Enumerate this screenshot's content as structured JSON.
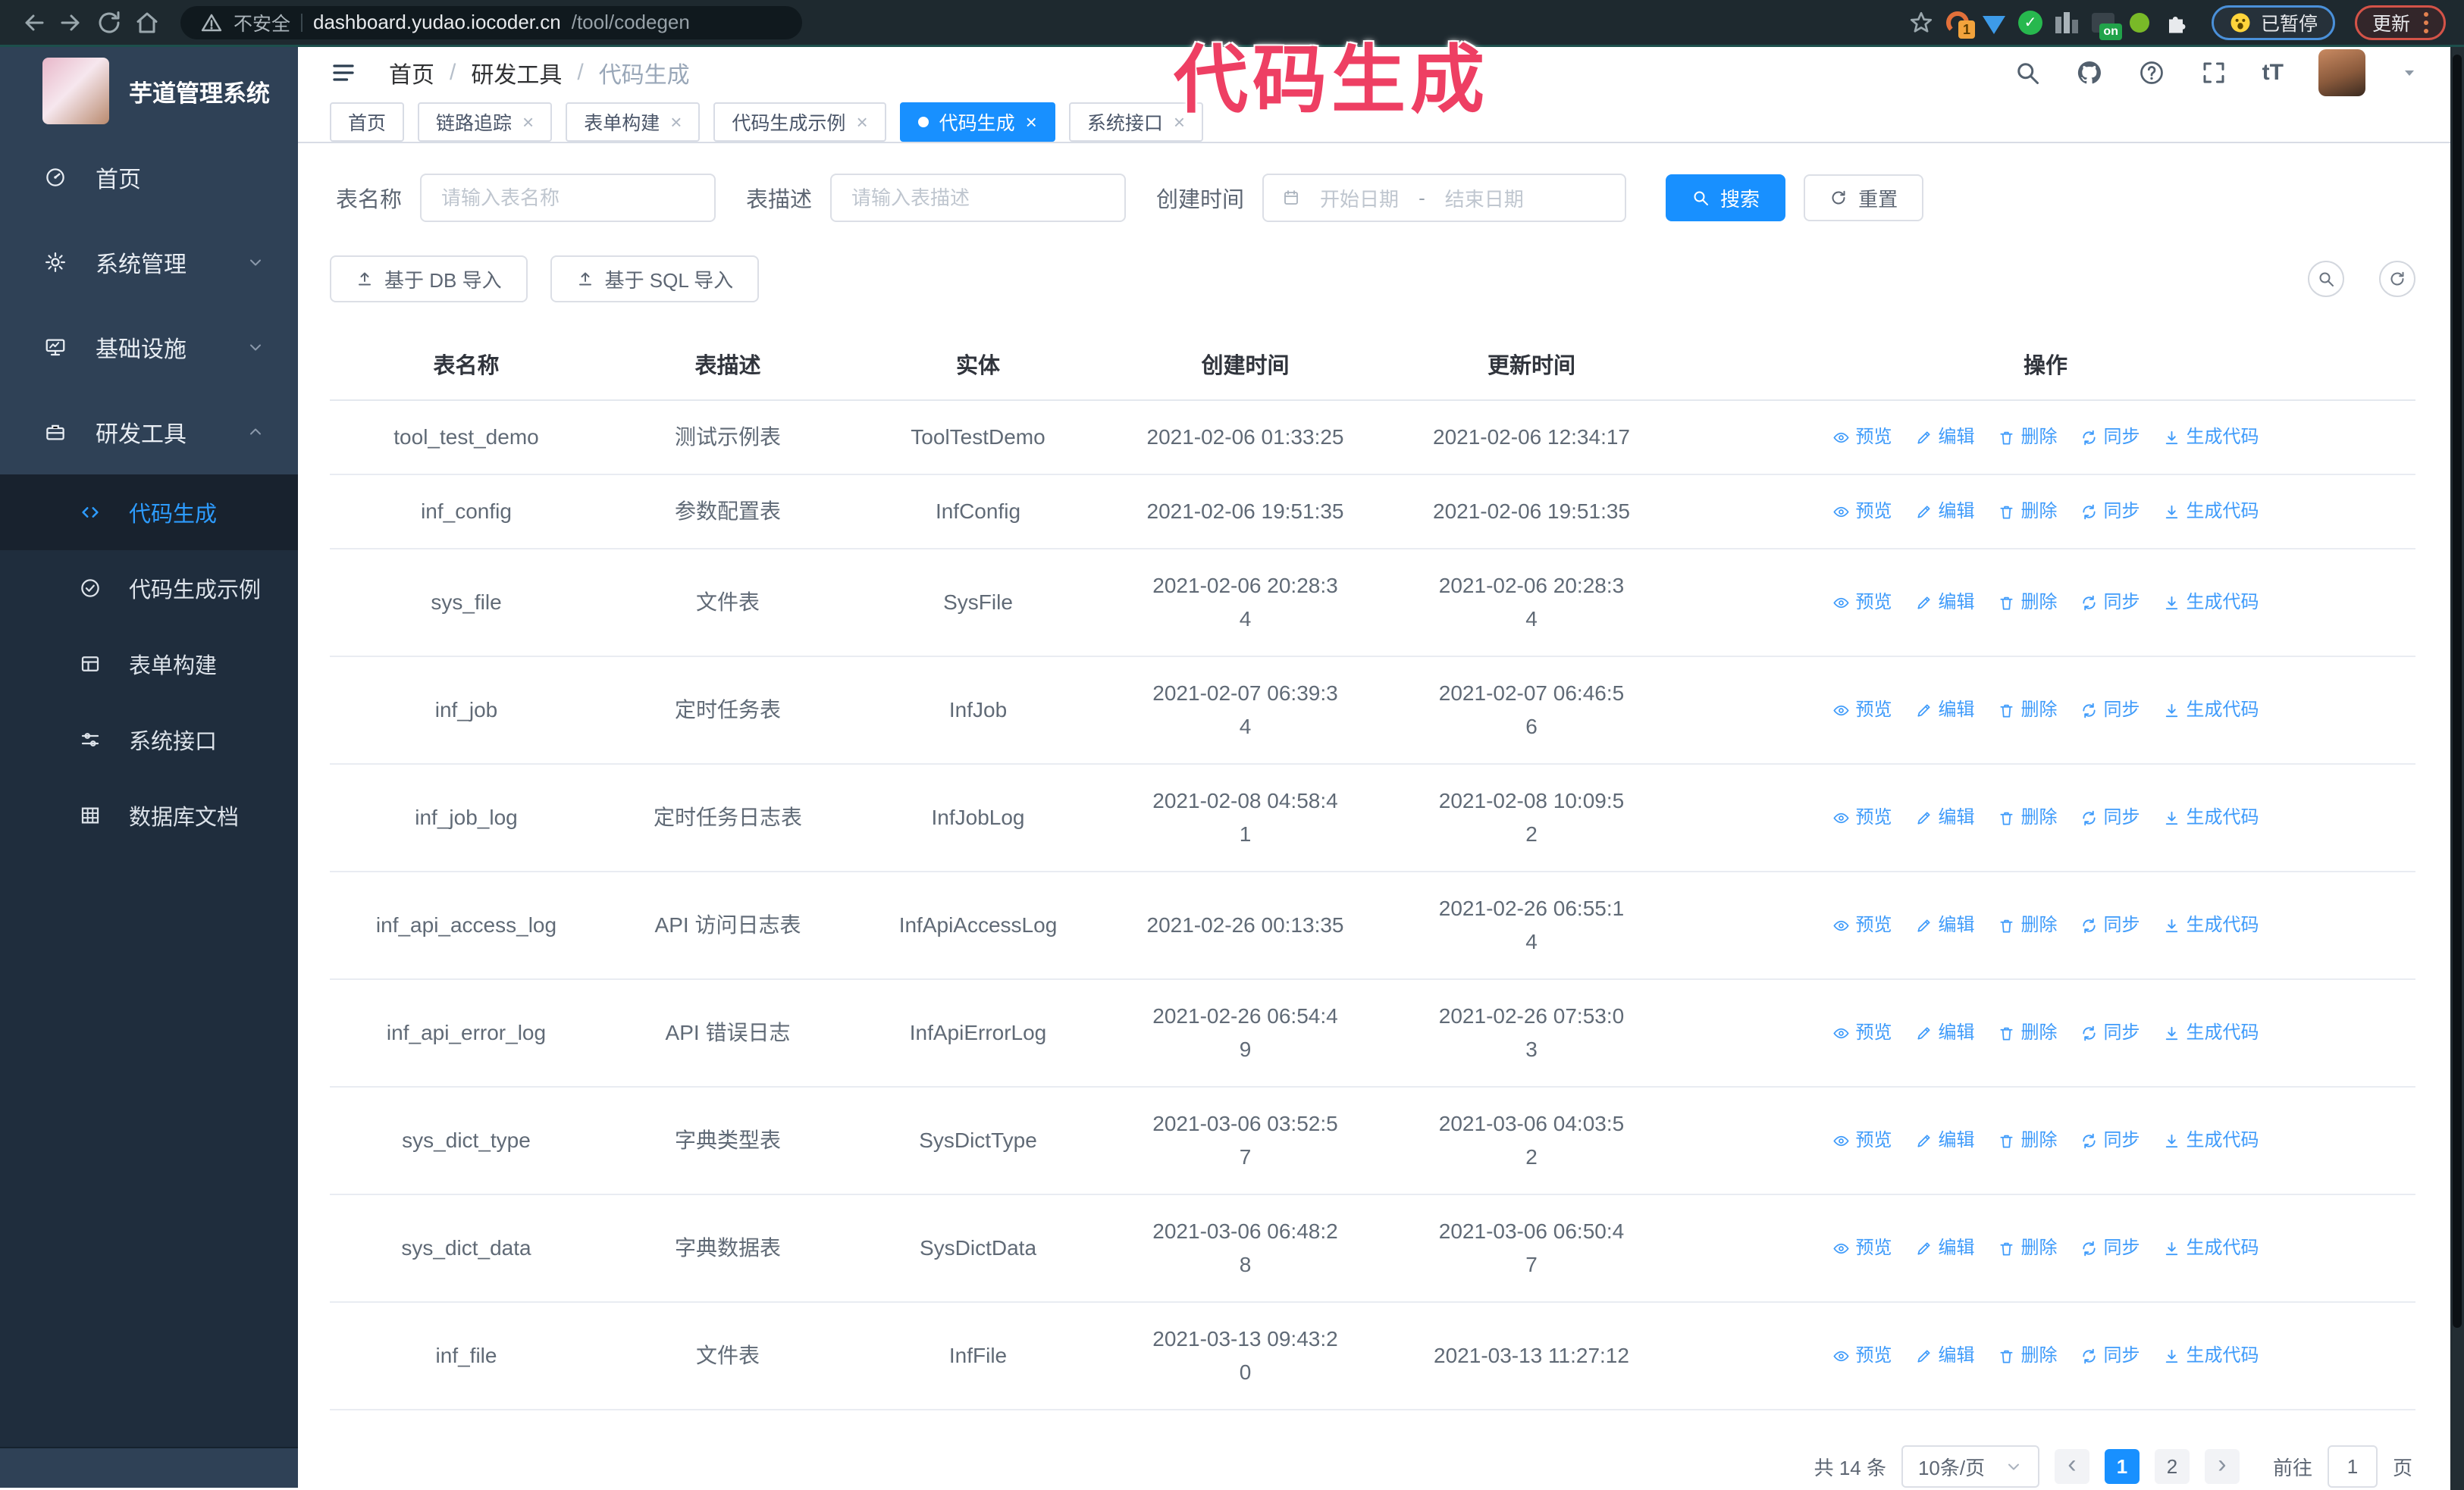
{
  "browser": {
    "security_label": "不安全",
    "url_host": "dashboard.yudao.iocoder.cn",
    "url_path": "/tool/codegen",
    "extension_badge": "1",
    "extension_on_badge": "on",
    "paused_badge": "已暂停",
    "update_button": "更新"
  },
  "annotation": {
    "title": "代码生成",
    "color": "#ee3f63"
  },
  "sidebar": {
    "logo_title": "芋道管理系统",
    "items": [
      {
        "label": "首页",
        "icon": "gauge-icon",
        "expandable": false
      },
      {
        "label": "系统管理",
        "icon": "gear-icon",
        "expandable": true
      },
      {
        "label": "基础设施",
        "icon": "monitor-icon",
        "expandable": true
      },
      {
        "label": "研发工具",
        "icon": "toolbox-icon",
        "expandable": true,
        "expanded": true
      }
    ],
    "submenu": [
      {
        "label": "代码生成",
        "icon": "code-icon",
        "active": true
      },
      {
        "label": "代码生成示例",
        "icon": "check-circle-icon",
        "active": false
      },
      {
        "label": "表单构建",
        "icon": "form-icon",
        "active": false
      },
      {
        "label": "系统接口",
        "icon": "sliders-icon",
        "active": false
      },
      {
        "label": "数据库文档",
        "icon": "table-grid-icon",
        "active": false
      }
    ]
  },
  "breadcrumb": [
    "首页",
    "研发工具",
    "代码生成"
  ],
  "tabs": [
    {
      "label": "首页",
      "closable": false,
      "active": false
    },
    {
      "label": "链路追踪",
      "closable": true,
      "active": false
    },
    {
      "label": "表单构建",
      "closable": true,
      "active": false
    },
    {
      "label": "代码生成示例",
      "closable": true,
      "active": false
    },
    {
      "label": "代码生成",
      "closable": true,
      "active": true
    },
    {
      "label": "系统接口",
      "closable": true,
      "active": false
    }
  ],
  "filters": {
    "table_name_label": "表名称",
    "table_name_placeholder": "请输入表名称",
    "table_desc_label": "表描述",
    "table_desc_placeholder": "请输入表描述",
    "create_time_label": "创建时间",
    "date_start_placeholder": "开始日期",
    "date_separator": "-",
    "date_end_placeholder": "结束日期",
    "search_button": "搜索",
    "reset_button": "重置"
  },
  "toolbar": {
    "import_db_button": "基于 DB 导入",
    "import_sql_button": "基于 SQL 导入"
  },
  "table": {
    "columns": [
      "表名称",
      "表描述",
      "实体",
      "创建时间",
      "更新时间",
      "操作"
    ],
    "actions": [
      "预览",
      "编辑",
      "删除",
      "同步",
      "生成代码"
    ],
    "rows": [
      {
        "name": "tool_test_demo",
        "desc": "测试示例表",
        "entity": "ToolTestDemo",
        "created": "2021-02-06 01:33:25",
        "updated": "2021-02-06 12:34:17"
      },
      {
        "name": "inf_config",
        "desc": "参数配置表",
        "entity": "InfConfig",
        "created": "2021-02-06 19:51:35",
        "updated": "2021-02-06 19:51:35"
      },
      {
        "name": "sys_file",
        "desc": "文件表",
        "entity": "SysFile",
        "created": "2021-02-06 20:28:3\n4",
        "updated": "2021-02-06 20:28:3\n4"
      },
      {
        "name": "inf_job",
        "desc": "定时任务表",
        "entity": "InfJob",
        "created": "2021-02-07 06:39:3\n4",
        "updated": "2021-02-07 06:46:5\n6"
      },
      {
        "name": "inf_job_log",
        "desc": "定时任务日志表",
        "entity": "InfJobLog",
        "created": "2021-02-08 04:58:4\n1",
        "updated": "2021-02-08 10:09:5\n2"
      },
      {
        "name": "inf_api_access_log",
        "desc": "API 访问日志表",
        "entity": "InfApiAccessLog",
        "created": "2021-02-26 00:13:35",
        "updated": "2021-02-26 06:55:1\n4"
      },
      {
        "name": "inf_api_error_log",
        "desc": "API 错误日志",
        "entity": "InfApiErrorLog",
        "created": "2021-02-26 06:54:4\n9",
        "updated": "2021-02-26 07:53:0\n3"
      },
      {
        "name": "sys_dict_type",
        "desc": "字典类型表",
        "entity": "SysDictType",
        "created": "2021-03-06 03:52:5\n7",
        "updated": "2021-03-06 04:03:5\n2"
      },
      {
        "name": "sys_dict_data",
        "desc": "字典数据表",
        "entity": "SysDictData",
        "created": "2021-03-06 06:48:2\n8",
        "updated": "2021-03-06 06:50:4\n7"
      },
      {
        "name": "inf_file",
        "desc": "文件表",
        "entity": "InfFile",
        "created": "2021-03-13 09:43:2\n0",
        "updated": "2021-03-13 11:27:12"
      }
    ]
  },
  "pagination": {
    "total_label": "共 14 条",
    "page_size": "10条/页",
    "pages": [
      "1",
      "2"
    ],
    "active_page": "1",
    "prev_glyph": "‹",
    "next_glyph": "›",
    "goto_label": "前往",
    "goto_value": "1",
    "page_label": "页"
  },
  "icons": {
    "back": "arrow-left",
    "forward": "arrow-right",
    "reload": "circular-arrow",
    "home": "house",
    "security": "warning-triangle",
    "bookmark": "star-outline",
    "extension_generic": "puzzle-piece",
    "search": "magnifier",
    "github": "octocat-circle",
    "help": "question-circle",
    "fullscreen": "expand-corners",
    "font_size": "tT",
    "user_menu": "caret-down",
    "sidebar_toggle": "hamburger-lines",
    "calendar": "calendar-grid",
    "reset": "refresh-arrows",
    "import": "upload-arrow",
    "preview": "eye",
    "edit": "pencil",
    "delete": "trash",
    "sync": "refresh-arrows",
    "generate_code": "download-arrow"
  },
  "colors": {
    "accent_blue": "#1890ff",
    "link_blue": "#409eff",
    "annotation_pink": "#ee3f63",
    "sidebar_bg": "#2f4156",
    "submenu_bg": "#1f2d3d",
    "chrome_bg": "#1e292f",
    "row_divider": "#e9ecf2"
  }
}
